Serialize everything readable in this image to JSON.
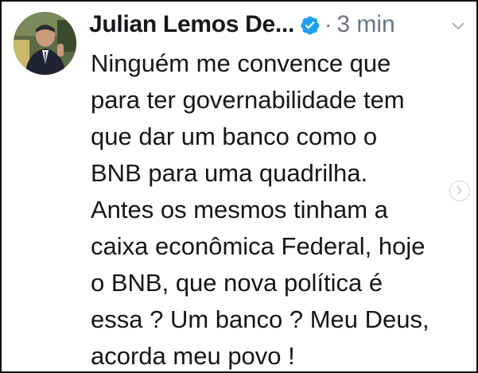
{
  "tweet": {
    "author_name": "Julian Lemos De...",
    "separator": "·",
    "timestamp": "3 min",
    "text_lines": [
      "Ninguém me convence que",
      "para ter governabilidade tem",
      "que dar um banco como o",
      "BNB para uma quadrilha.",
      "Antes os mesmos tinham a",
      "caixa econômica Federal, hoje",
      "o BNB, que nova política é",
      "essa ? Um banco ? Meu Deus,",
      "acorda meu povo !"
    ]
  },
  "icons": {
    "verified": "verified-badge-icon",
    "more": "chevron-down-icon",
    "next": "chevron-right-icon"
  },
  "colors": {
    "verified_blue": "#1da1f2",
    "text_primary": "#14171a",
    "text_secondary": "#657786"
  }
}
